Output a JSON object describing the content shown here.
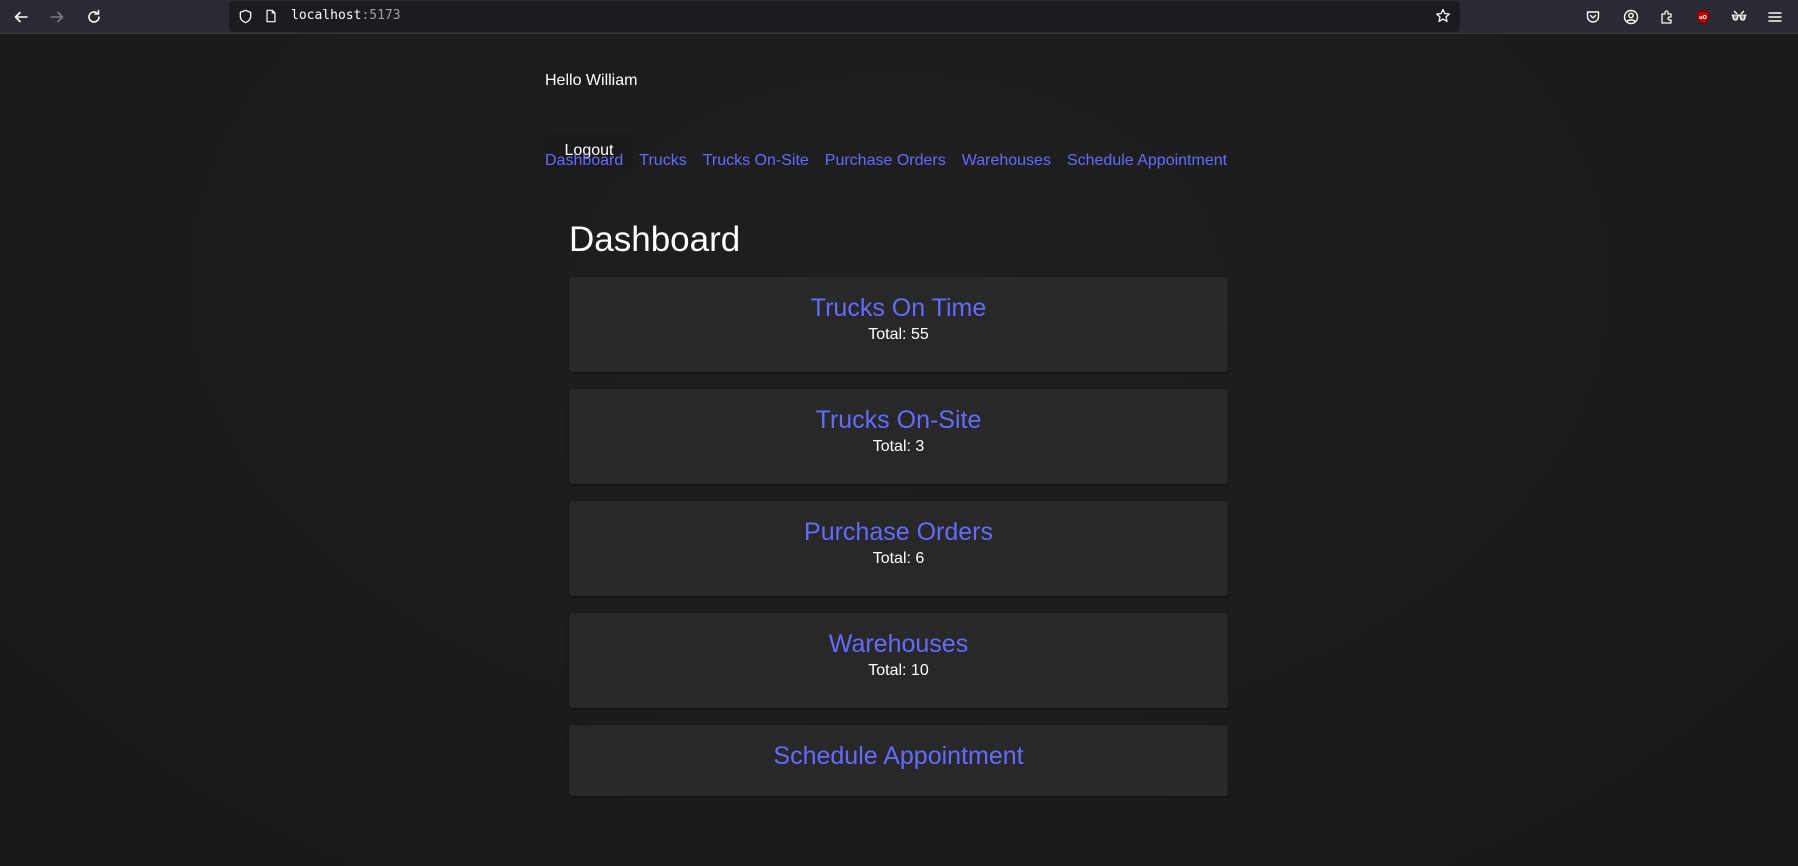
{
  "browser": {
    "url_host": "localhost",
    "url_port": ":5173"
  },
  "user": {
    "greeting": "Hello William",
    "logout_label": "Logout"
  },
  "nav": {
    "items": [
      {
        "label": "Dashboard"
      },
      {
        "label": "Trucks"
      },
      {
        "label": "Trucks On-Site"
      },
      {
        "label": "Purchase Orders"
      },
      {
        "label": "Warehouses"
      },
      {
        "label": "Schedule Appointment"
      }
    ]
  },
  "main": {
    "title": "Dashboard",
    "cards": [
      {
        "title": "Trucks On Time",
        "total": "Total: 55"
      },
      {
        "title": "Trucks On-Site",
        "total": "Total: 3"
      },
      {
        "title": "Purchase Orders",
        "total": "Total: 6"
      },
      {
        "title": "Warehouses",
        "total": "Total: 10"
      },
      {
        "title": "Schedule Appointment"
      }
    ]
  },
  "colors": {
    "accent": "#646cff",
    "background": "#1b1b1b",
    "card": "#282828"
  }
}
